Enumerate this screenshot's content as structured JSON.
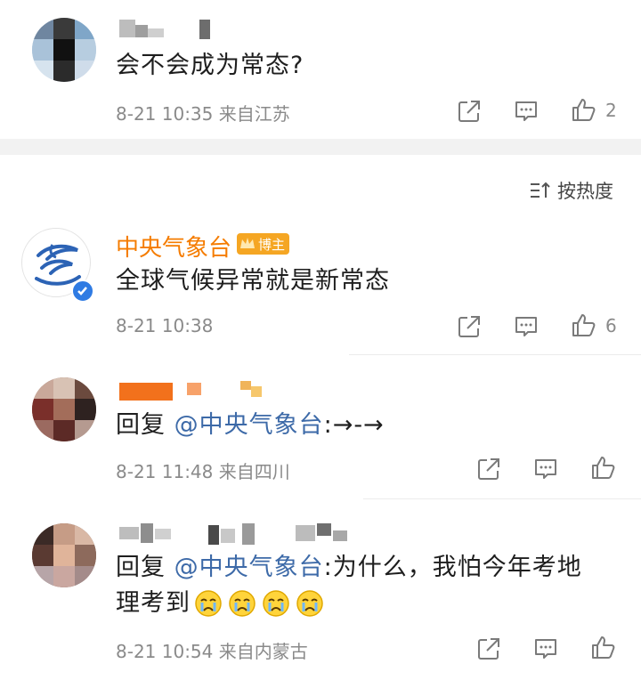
{
  "comments": [
    {
      "text": "会不会成为常态?",
      "meta": "8-21 10:35 来自江苏",
      "like_count": "2"
    }
  ],
  "sort_label": "按热度",
  "thread": {
    "author": {
      "name": "中央气象台",
      "badge": "博主",
      "badge_color": "#f5a623",
      "name_color": "#f57c00"
    },
    "text": "全球气候异常就是新常态",
    "meta": "8-21 10:38",
    "like_count": "6",
    "replies": [
      {
        "prefix": "回复 ",
        "mention": "@中央气象台",
        "suffix": ":→-→",
        "meta": "8-21 11:48 来自四川"
      },
      {
        "prefix": "回复 ",
        "mention": "@中央气象台",
        "suffix": ":为什么，我怕今年考地",
        "line2": "理考到",
        "emoji": "crying-face",
        "meta": "8-21 10:54 来自内蒙古"
      }
    ]
  },
  "colors": {
    "link": "#3d6aa8",
    "meta": "#8a8a8a",
    "band": "#f2f2f2"
  }
}
